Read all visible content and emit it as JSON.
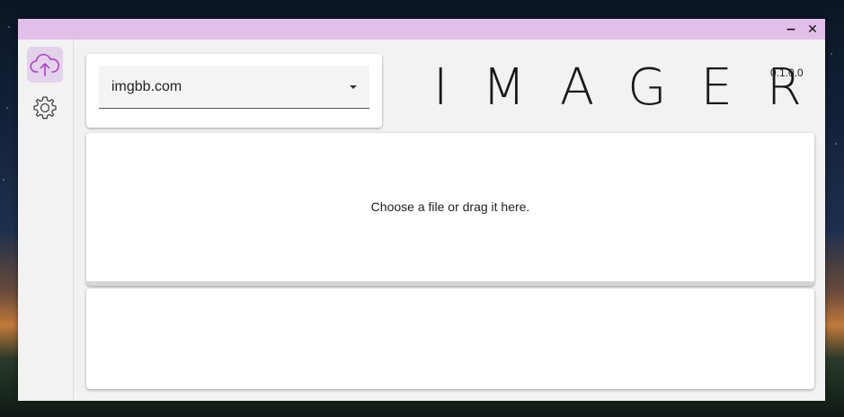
{
  "window": {
    "minimize_label": "−",
    "close_label": "✕"
  },
  "sidebar": {
    "items": [
      {
        "name": "upload",
        "icon": "cloud-upload-icon",
        "active": true
      },
      {
        "name": "settings",
        "icon": "gear-icon",
        "active": false
      }
    ]
  },
  "host_select": {
    "value": "imgbb.com"
  },
  "app": {
    "title": "IMAGER",
    "version": "0.1.0.0"
  },
  "dropzone": {
    "text": "Choose a file or drag it here."
  },
  "colors": {
    "titlebar": "#e2bfe9",
    "accent": "#b040c8",
    "active_item_bg": "#e3d3ea"
  }
}
